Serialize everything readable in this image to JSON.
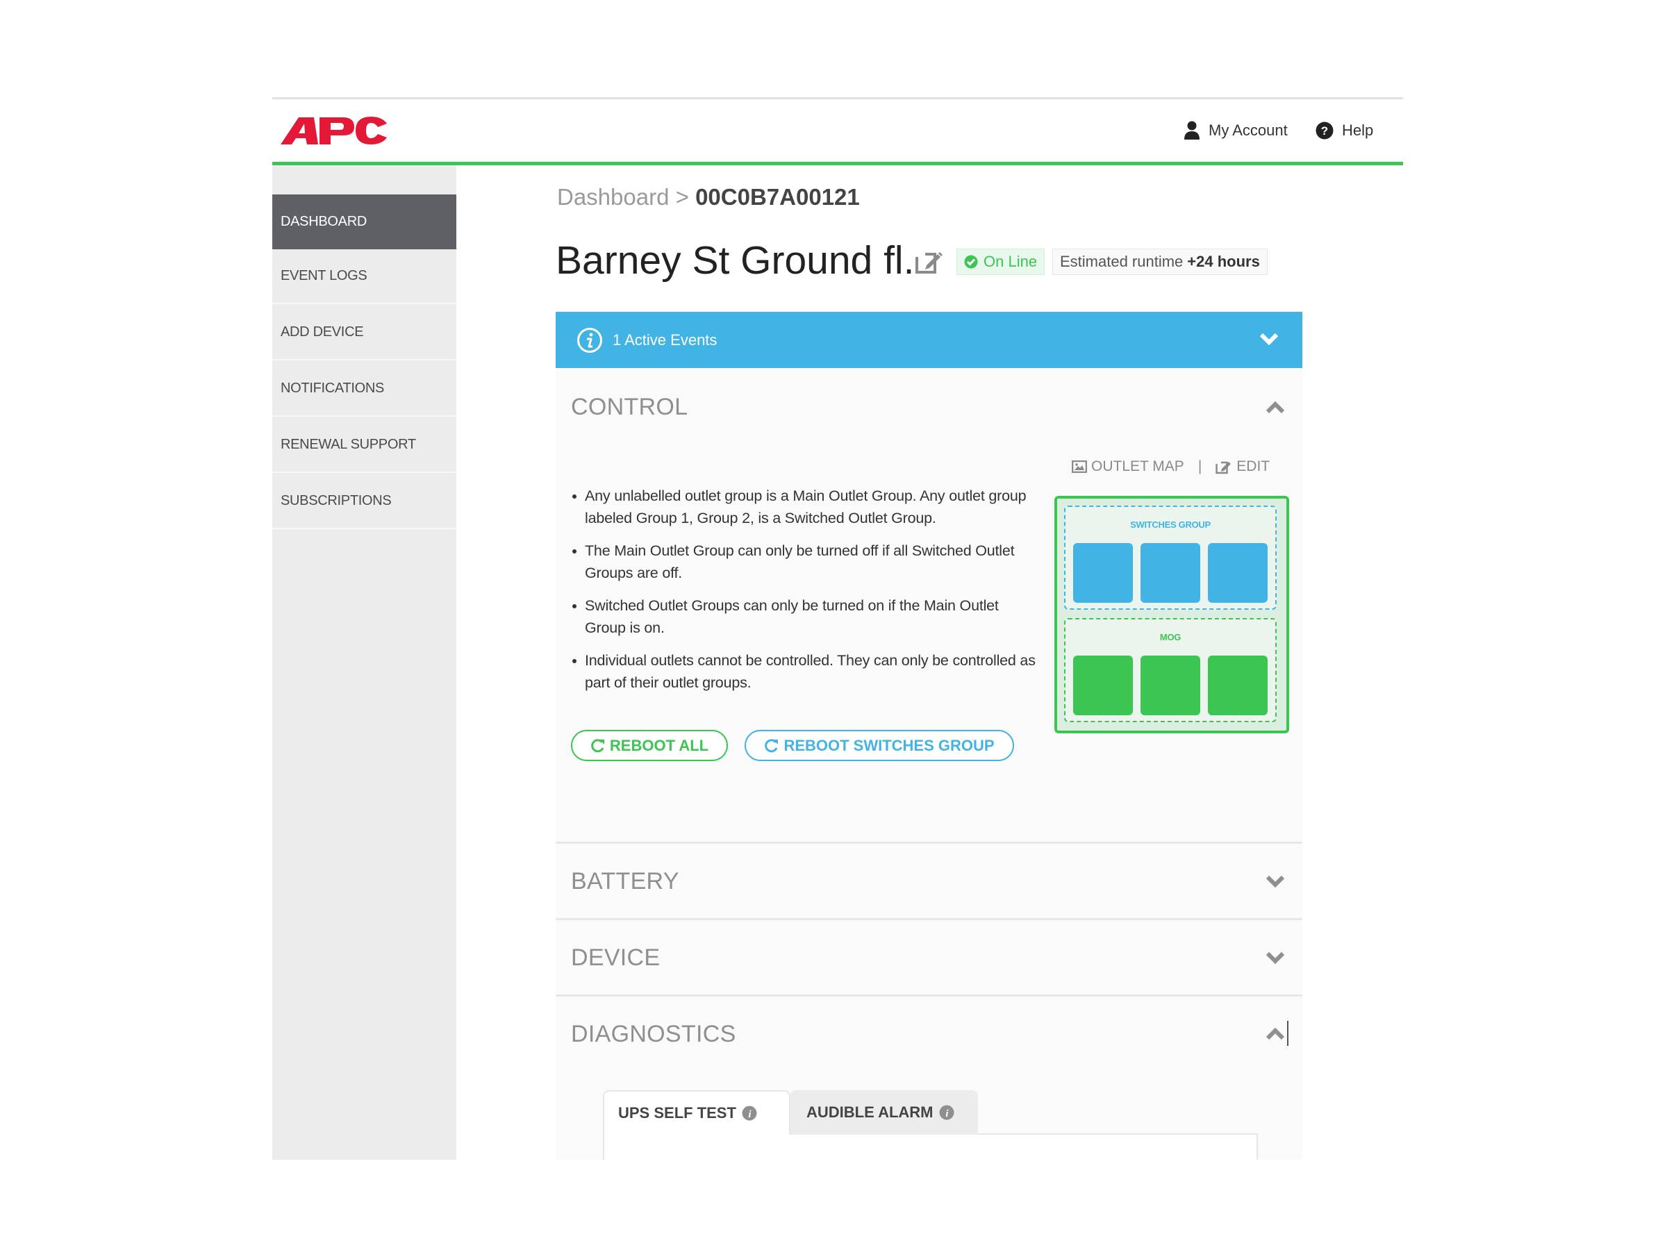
{
  "brand": {
    "logo_text": "APC",
    "color": "#e31937"
  },
  "header": {
    "account_label": "My Account",
    "help_label": "Help",
    "account_icon": "user-icon",
    "help_icon": "question-circle-icon"
  },
  "sidebar": {
    "items": [
      {
        "label": "DASHBOARD",
        "active": true
      },
      {
        "label": "EVENT LOGS",
        "active": false
      },
      {
        "label": "ADD DEVICE",
        "active": false
      },
      {
        "label": "NOTIFICATIONS",
        "active": false
      },
      {
        "label": "RENEWAL SUPPORT",
        "active": false
      },
      {
        "label": "SUBSCRIPTIONS",
        "active": false
      }
    ]
  },
  "breadcrumb": {
    "root": "Dashboard",
    "separator": ">",
    "current": "00C0B7A00121"
  },
  "device": {
    "name": "Barney St Ground fl.",
    "status": "On Line",
    "runtime_label": "Estimated runtime",
    "runtime_value": "+24 hours"
  },
  "events": {
    "label": "1 Active Events",
    "icon": "info-circle-icon"
  },
  "sections": {
    "control": {
      "title": "CONTROL",
      "expanded": true,
      "outlet_map_label": "OUTLET MAP",
      "edit_label": "EDIT",
      "separator": "|",
      "bullets": [
        "Any unlabelled outlet group is a Main Outlet Group. Any outlet group labeled Group 1, Group 2, is a Switched Outlet Group.",
        "The Main Outlet Group can only be turned off if all Switched Outlet Groups are off.",
        "Switched Outlet Groups can only be turned on if the Main Outlet Group is on.",
        "Individual outlets cannot be controlled. They can only be controlled as part of their outlet groups."
      ],
      "outlet_map": {
        "switched_group_label": "SWITCHES GROUP",
        "switched_outlet_count": 3,
        "main_group_label": "MOG",
        "main_outlet_count": 3
      },
      "buttons": {
        "reboot_all": "REBOOT ALL",
        "reboot_switches": "REBOOT SWITCHES GROUP"
      }
    },
    "battery": {
      "title": "BATTERY",
      "expanded": false
    },
    "device": {
      "title": "DEVICE",
      "expanded": false
    },
    "diagnostics": {
      "title": "DIAGNOSTICS",
      "expanded": true,
      "tabs": [
        {
          "label": "UPS SELF TEST",
          "active": true
        },
        {
          "label": "AUDIBLE ALARM",
          "active": false
        }
      ]
    }
  },
  "colors": {
    "accent_green": "#3dc553",
    "accent_blue": "#42b3e5",
    "sidebar_active": "#5f6065",
    "brand_red": "#e31937"
  }
}
